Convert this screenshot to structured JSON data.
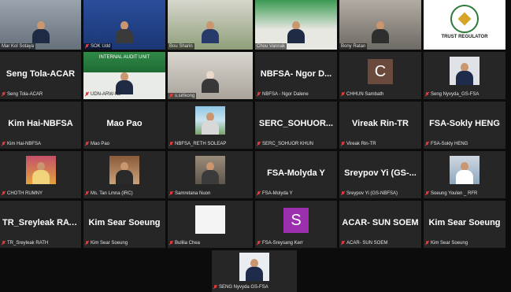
{
  "tiles": [
    {
      "caption": "Mar Kol Sotaya"
    },
    {
      "caption": "SOK Udd"
    },
    {
      "caption": "Bou Sharin"
    },
    {
      "caption": "Chou Vannak"
    },
    {
      "caption": "Bony Ratan"
    },
    {
      "caption": "TRUST REGULATOR"
    },
    {
      "big": "Seng Tola-ACAR",
      "caption": "Seng Tola-ACAR"
    },
    {
      "caption": "UDN-ARW-NJ",
      "banner": "INTERNAL AUDIT UNIT"
    },
    {
      "caption": "s.sirikong"
    },
    {
      "big": "NBFSA- Ngor D...",
      "caption": "NBFSA - Ngor Dalene"
    },
    {
      "letter": "C",
      "caption": "CHHUN Sambath"
    },
    {
      "caption": "Seng Nyvyda_GS-FSA"
    },
    {
      "big": "Kim Hai-NBFSA",
      "caption": "Kim Hai-NBFSA"
    },
    {
      "big": "Mao Pao",
      "caption": "Mao Pao"
    },
    {
      "caption": "NBFSA_RETH SOLEAP"
    },
    {
      "big": "SERC_SOHUOR...",
      "caption": "SERC_SOHUOR KHUN"
    },
    {
      "big": "Vireak Rin-TR",
      "caption": "Vireak Rin-TR"
    },
    {
      "big": "FSA-Sokly HENG",
      "caption": "FSA-Sokly HENG"
    },
    {
      "caption": "CHOTH RUMNY"
    },
    {
      "caption": "Ms. Tan Lmna (IRC)"
    },
    {
      "caption": "Samretana Nuon"
    },
    {
      "big": "FSA-Molyda Y",
      "caption": "FSA-Molyda Y"
    },
    {
      "big": "Sreypov Yi (GS-...",
      "caption": "Sreypov Yi (GS-NBFSA)"
    },
    {
      "caption": "Soeung Youlen _ RFR"
    },
    {
      "big": "TR_Sreyleak RATH",
      "caption": "TR_Sreyleak RATH"
    },
    {
      "big": "Kim Sear Soeung",
      "caption": "Kim Sear Soeung"
    },
    {
      "caption": "Bulilia Chea"
    },
    {
      "letter": "S",
      "caption": "FSA-Sreysang Kerr"
    },
    {
      "big": "ACAR- SUN SOEM",
      "caption": "ACAR- SUN SOEM"
    },
    {
      "big": "Kim Sear Soeung",
      "caption": "Kim Sear Soeung"
    },
    {
      "caption": "SENG Nyvyda GS-FSA"
    }
  ],
  "colors": {
    "tile_bg": "#262626",
    "page_bg": "#0c0c0c",
    "active_outline": "#c8e33a",
    "muted_mic": "#e23b3b",
    "letter_c_bg": "#6b4a3e",
    "letter_s_bg": "#9b2fae"
  }
}
